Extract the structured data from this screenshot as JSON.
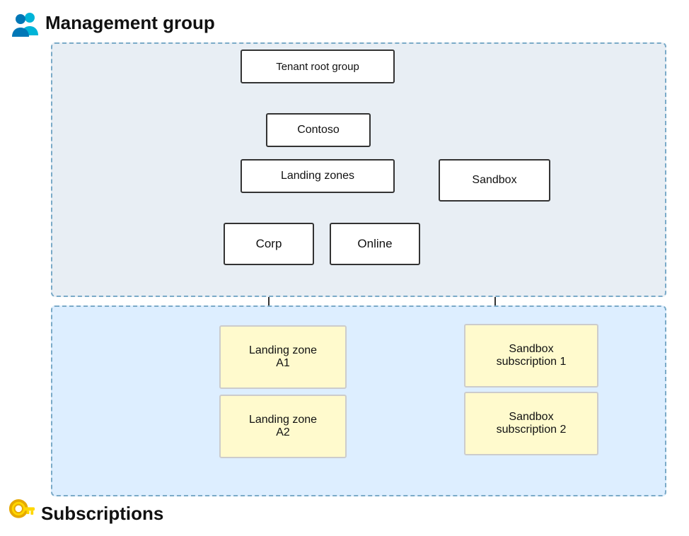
{
  "labels": {
    "management_group": "Management group",
    "subscriptions": "Subscriptions"
  },
  "nodes": {
    "tenant_root": "Tenant root group",
    "contoso": "Contoso",
    "landing_zones": "Landing zones",
    "sandbox": "Sandbox",
    "corp": "Corp",
    "online": "Online",
    "lz_a1": "Landing zone\nA1",
    "lz_a2": "Landing zone\nA2",
    "sandbox_sub1": "Sandbox\nsubscription 1",
    "sandbox_sub2": "Sandbox\nsubscription 2"
  }
}
